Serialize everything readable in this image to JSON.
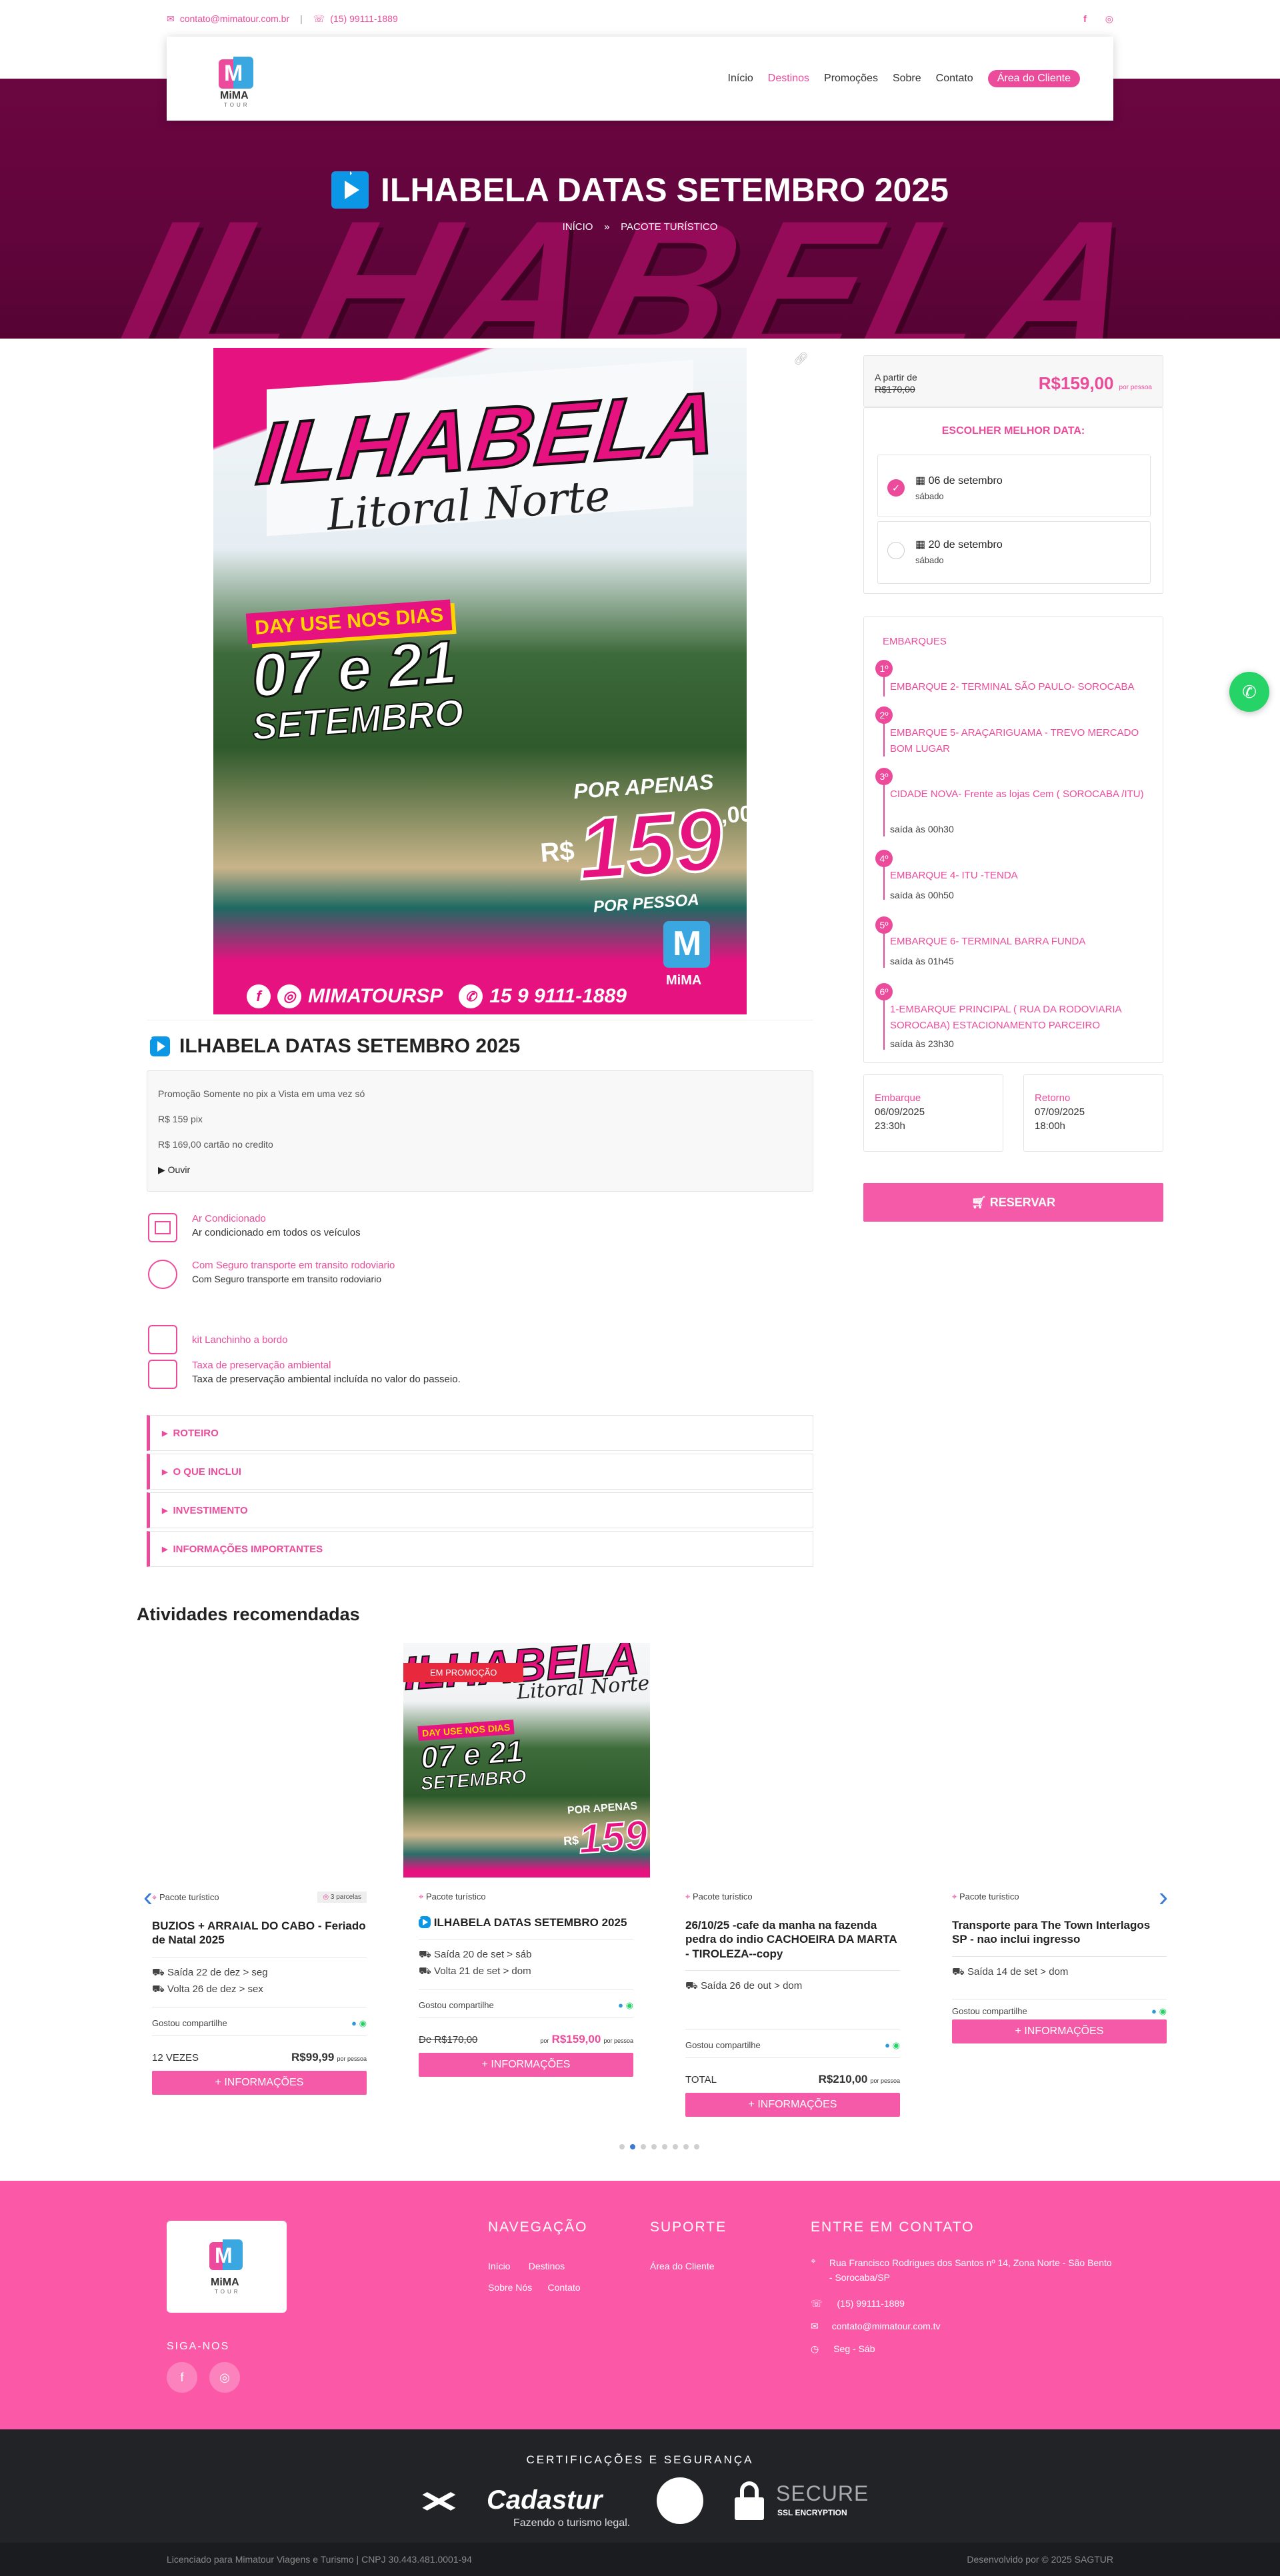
{
  "topbar": {
    "email": "contato@mimatour.com.br",
    "phone": "(15) 99111-1889"
  },
  "nav": {
    "items": [
      "Início",
      "Destinos",
      "Promoções",
      "Sobre",
      "Contato"
    ],
    "client_area": "Área do Cliente"
  },
  "logo": {
    "text": "MiMA",
    "sub": "TOUR"
  },
  "hero": {
    "bg_word": "ILHABELA",
    "title": "ILHABELA DATAS SETEMBRO 2025",
    "crumb_home": "INÍCIO",
    "crumb_sep": "»",
    "crumb_current": "PACOTE TURÍSTICO"
  },
  "poster": {
    "title": "ILHABELA",
    "subtitle": "Litoral Norte",
    "tag": "DAY USE NOS DIAS",
    "dates_line1": "07 e 21",
    "dates_line2": "SETEMBRO",
    "por_apenas": "POR APENAS",
    "currency": "R$",
    "price": "159",
    "cents": ",00",
    "per": "POR PESSOA",
    "handle": "MIMATOURSP",
    "phone": "15 9 9111-1889"
  },
  "package": {
    "title": "ILHABELA DATAS SETEMBRO 2025",
    "desc1": "Promoção Somente no pix a Vista em uma vez só",
    "desc2": "R$ 159 pix",
    "desc3": "R$ 169,00 cartão no credito",
    "listen": "Ouvir"
  },
  "features": [
    {
      "title": "Ar Condicionado",
      "desc": "Ar condicionado em todos os veículos"
    },
    {
      "title": "Com Seguro transporte em transito rodoviario",
      "desc": "Com Seguro transporte em transito rodoviario"
    },
    {
      "title": "kit Lanchinho a bordo",
      "desc": ""
    },
    {
      "title": "Taxa de preservação ambiental",
      "desc": "Taxa de preservação ambiental incluída no valor do passeio."
    }
  ],
  "accordion": [
    "ROTEIRO",
    "O QUE INCLUI",
    "INVESTIMENTO",
    "INFORMAÇÕES IMPORTANTES"
  ],
  "booking": {
    "from_label": "A partir de",
    "old_price": "R$170,00",
    "price": "R$159,00",
    "per": "por pessoa",
    "choose_label": "ESCOLHER MELHOR DATA:",
    "dates": [
      {
        "date": "06 de setembro",
        "day": "sábado"
      },
      {
        "date": "20 de setembro",
        "day": "sábado"
      }
    ],
    "boarding_title": "EMBARQUES",
    "boardings": [
      {
        "n": "1º",
        "name": "EMBARQUE 2- TERMINAL SÃO PAULO- SOROCABA",
        "time": ""
      },
      {
        "n": "2º",
        "name": "EMBARQUE 5- ARAÇARIGUAMA - TREVO MERCADO BOM LUGAR",
        "time": ""
      },
      {
        "n": "3º",
        "name": "CIDADE NOVA- Frente as lojas Cem ( SOROCABA /ITU)",
        "time": "saída às 00h30"
      },
      {
        "n": "4º",
        "name": "EMBARQUE 4- ITU -TENDA",
        "time": "saída às 00h50"
      },
      {
        "n": "5º",
        "name": "EMBARQUE 6- TERMINAL BARRA FUNDA",
        "time": "saída às 01h45"
      },
      {
        "n": "6º",
        "name": "1-EMBARQUE PRINCIPAL ( RUA DA RODOVIARIA SOROCABA) ESTACIONAMENTO PARCEIRO",
        "time": "saída às 23h30"
      }
    ],
    "embarque_label": "Embarque",
    "embarque_date": "06/09/2025",
    "embarque_time": "23:30h",
    "retorno_label": "Retorno",
    "retorno_date": "07/09/2025",
    "retorno_time": "18:00h",
    "reserve": "RESERVAR"
  },
  "recommended": {
    "heading": "Atividades recomendadas",
    "promo_badge": "EM PROMOÇÃO",
    "cards": [
      {
        "cat": "Pacote turístico",
        "badge": "3 parcelas",
        "title": "BUZIOS + ARRAIAL DO CABO - Feriado de Natal 2025",
        "l1": "Saída 22 de dez > seg",
        "l2": "Volta 26 de dez > sex",
        "liked": "Gostou compartilhe",
        "left": "12 VEZES",
        "price": "R$99,99",
        "per": "por pessoa",
        "btn": "INFORMAÇÕES"
      },
      {
        "cat": "Pacote turístico",
        "title": "ILHABELA DATAS SETEMBRO 2025",
        "l1": "Saída 20 de set > sáb",
        "l2": "Volta 21 de set > dom",
        "liked": "Gostou compartilhe",
        "left": "De R$170,00",
        "por": "por",
        "price": "R$159,00",
        "per": "por pessoa",
        "btn": "INFORMAÇÕES"
      },
      {
        "cat": "Pacote turístico",
        "title": "26/10/25 -cafe da manha na fazenda pedra do indio CACHOEIRA DA MARTA - TIROLEZA--copy",
        "l1": "Saída 26 de out > dom",
        "liked": "Gostou compartilhe",
        "left": "TOTAL",
        "price": "R$210,00",
        "per": "por pessoa",
        "btn": "INFORMAÇÕES"
      },
      {
        "cat": "Pacote turístico",
        "title": "Transporte para The Town Interlagos SP - nao inclui ingresso",
        "l1": "Saída 14 de set > dom",
        "liked": "Gostou compartilhe",
        "btn": "INFORMAÇÕES"
      }
    ]
  },
  "footer": {
    "nav_title": "NAVEGAÇÃO",
    "nav": [
      "Início",
      "Destinos",
      "Sobre Nós",
      "Contato"
    ],
    "support_title": "SUPORTE",
    "support": [
      "Área do Cliente"
    ],
    "contact_title": "ENTRE EM CONTATO",
    "address": "Rua Francisco Rodrigues dos Santos nº 14, Zona Norte - São Bento - Sorocaba/SP",
    "phone": "(15) 99111-1889",
    "email": "contato@mimatour.com.tv",
    "hours": "Seg - Sáb",
    "follow": "SIGA-NOS"
  },
  "cert": {
    "title": "CERTIFICAÇÕES E SEGURANÇA",
    "cadastur": "Cadastur",
    "cadastur_sub": "Fazendo o turismo legal.",
    "secure": "SECURE",
    "ssl": "SSL ENCRYPTION"
  },
  "bottom": {
    "left": "Licenciado para Mimatour Viagens e Turismo | CNPJ 30.443.481.0001-94",
    "right": "Desenvolvido por © 2025 SAGTUR"
  }
}
